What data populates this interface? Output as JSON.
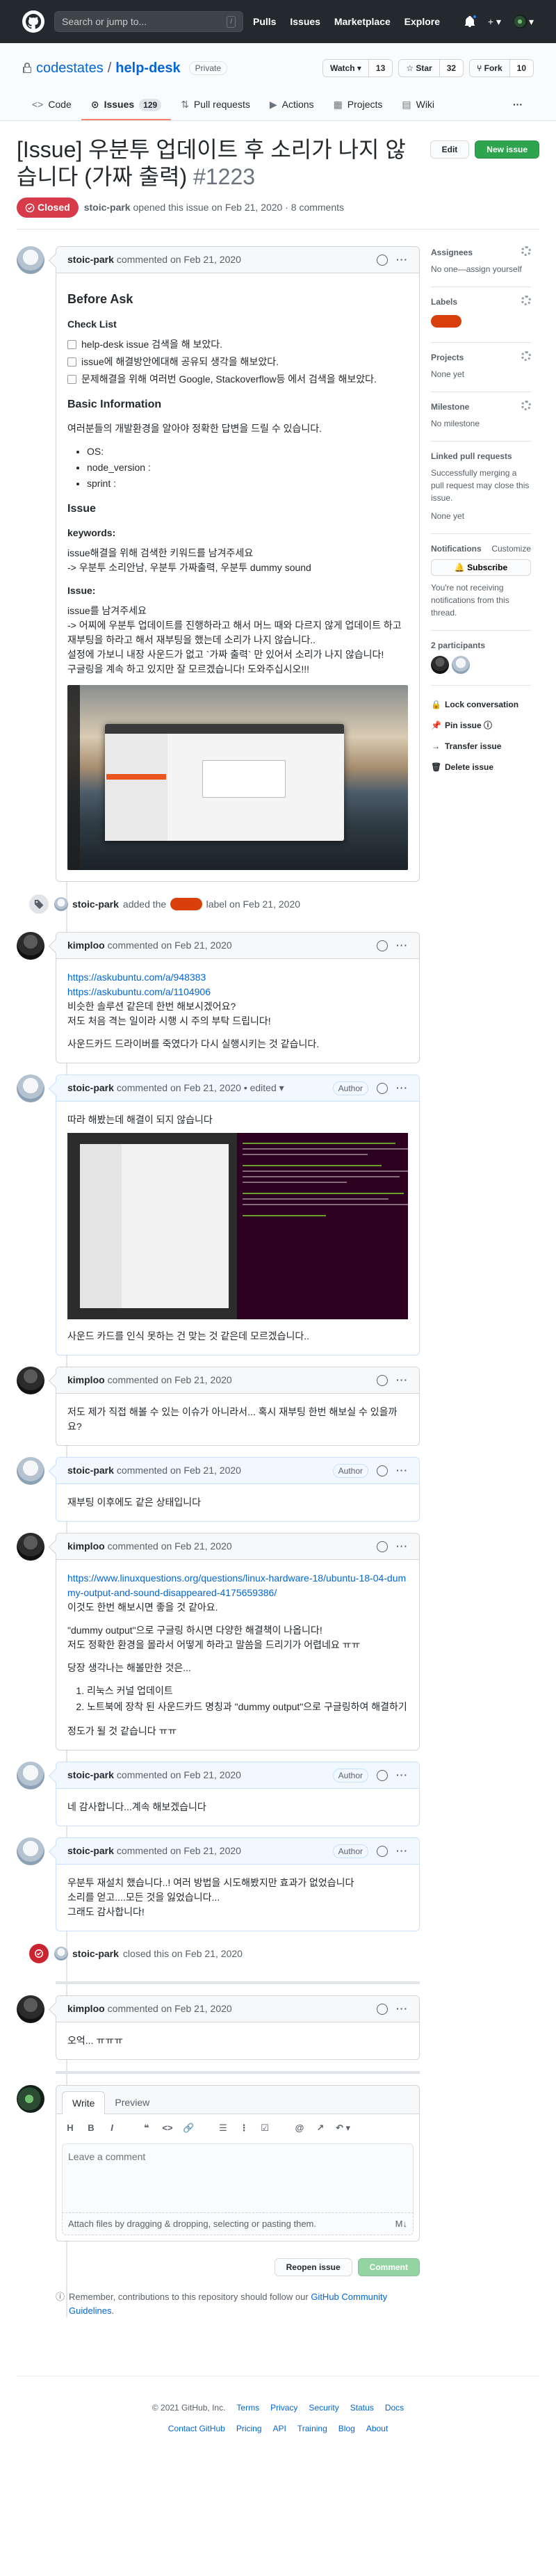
{
  "header": {
    "search_placeholder": "Search or jump to...",
    "search_key": "/",
    "nav": [
      "Pulls",
      "Issues",
      "Marketplace",
      "Explore"
    ],
    "plus_label": "+ ▾",
    "profile_label": "▾"
  },
  "repo": {
    "owner": "codestates",
    "separator": "/",
    "name": "help-desk",
    "visibility": "Private",
    "watch_label": "Watch ▾",
    "watch_count": "13",
    "star_label": "☆ Star",
    "star_count": "32",
    "fork_label": "Fork",
    "fork_count": "10",
    "tabs": [
      {
        "label": "Code",
        "icon": "<>"
      },
      {
        "label": "Issues",
        "icon": "⊙",
        "count": "129"
      },
      {
        "label": "Pull requests",
        "icon": "⇅"
      },
      {
        "label": "Actions",
        "icon": "▶"
      },
      {
        "label": "Projects",
        "icon": "▦"
      },
      {
        "label": "Wiki",
        "icon": "▤"
      }
    ],
    "more_label": "···"
  },
  "issue": {
    "title": "[Issue] 우분투 업데이트 후 소리가 나지 않습니다 (가짜 출력)",
    "number": "#1223",
    "edit_label": "Edit",
    "new_issue_label": "New issue",
    "state": "Closed",
    "author": "stoic-park",
    "opened_text": "opened this issue on Feb 21, 2020 · 8 comments"
  },
  "comments": [
    {
      "author": "stoic-park",
      "date": "commented on Feb 21, 2020",
      "badge": "",
      "body": {
        "h_before": "Before Ask",
        "h_checklist": "Check List",
        "checks": [
          "help-desk issue 검색을 해 보았다.",
          "issue에 해결방안에대해 공유되 생각을 해보았다.",
          "문제해결을 위해 여러번 Google, Stackoverflow등 에서 검색을 해보았다."
        ],
        "h_basic": "Basic Information",
        "basic_desc": "여러분들의 개발환경을 알아야 정확한 답변을 드릴 수 있습니다.",
        "env": [
          "OS:",
          "node_version :",
          "sprint :"
        ],
        "h_issue": "Issue",
        "h_keywords": "keywords:",
        "kw_line1": "issue해결을 위해 검색한 키워드를 남겨주세요",
        "kw_line2": "-> 우분투 소리안남, 우분투 가짜출력, 우분투 dummy sound",
        "h_issue2": "Issue:",
        "issue_line1": "issue를 남겨주세요",
        "issue_line2": "-> 어찌에 우분투 업데이트를 진행하라고 해서 머느 때와 다르지 않게 업데이트 하고 재부팅을 하라고 해서 재부팅을 했는데 소리가 나지 않습니다..",
        "issue_line3": "설정에 가보니 내장 사운드가 없고 `가짜 출력` 만 있어서 소리가 나지 않습니다!",
        "issue_line4": "구글링을 계속 하고 있지만 잘 모르겠습니다! 도와주십시오!!!"
      }
    },
    {
      "author": "kimploo",
      "date": "commented on Feb 21, 2020",
      "badge": "",
      "lines": [
        "https://askubuntu.com/a/948383",
        "https://askubuntu.com/a/1104906",
        "비슷한 솔루션 같은데 한번 해보시겠어요?",
        "저도 처음 격는 일이라 시행 시 주의 부탁 드립니다!",
        "사운드카드 드라이버를 죽였다가 다시 실행시키는 것 같습니다."
      ]
    },
    {
      "author": "stoic-park",
      "date": "commented on Feb 21, 2020 • edited ▾",
      "badge": "Author",
      "line1": "따라 해봤는데 해결이 되지 않습니다",
      "line2": "사운드 카드를 인식 못하는 건 맞는 것 같은데 모르겠습니다.."
    },
    {
      "author": "kimploo",
      "date": "commented on Feb 21, 2020",
      "text": "저도 제가 직접 해볼 수 있는 이슈가 아니라서... 혹시 재부팅 한번 해보실 수 있을까요?"
    },
    {
      "author": "stoic-park",
      "date": "commented on Feb 21, 2020",
      "badge": "Author",
      "text": "재부팅 이후에도 같은 상태입니다"
    },
    {
      "author": "kimploo",
      "date": "commented on Feb 21, 2020",
      "link": "https://www.linuxquestions.org/questions/linux-hardware-18/ubuntu-18-04-dummy-output-and-sound-disappeared-4175659386/",
      "line1": "이것도 한번 해보시면 좋을 것 같아요.",
      "line2": "\"dummy output\"으로 구글링 하시면 다양한 해결책이 나옵니다!",
      "line3": "저도 정확한 환경을 몰라서 어떻게 하라고 말씀을 드리기가 어렵네요 ㅠㅠ",
      "line4": "당장 생각나는 해볼만한 것은...",
      "items": [
        "리눅스 커널 업데이트",
        "노트북에 장착 된 사운드카드 명칭과 \"dummy output\"으로 구글링하여 해결하기"
      ],
      "line5": "정도가 될 것 같습니다 ㅠㅠ"
    },
    {
      "author": "stoic-park",
      "date": "commented on Feb 21, 2020",
      "badge": "Author",
      "text": "네 감사합니다...계속 해보겠습니다"
    },
    {
      "author": "stoic-park",
      "date": "commented on Feb 21, 2020",
      "badge": "Author",
      "line1": "우분투 재설치 했습니다..! 여러 방법을 시도해봤지만 효과가 없었습니다",
      "line2": "소리를 얻고....모든 것을 잃었습니다...",
      "line3": "그래도 감사합니다!"
    },
    {
      "author": "kimploo",
      "date": "commented on Feb 21, 2020",
      "text": "오억... ㅠㅠㅠ"
    }
  ],
  "events": {
    "labeled": {
      "author": "stoic-park",
      "pre": "added the",
      "post": "label on Feb 21, 2020"
    },
    "closed": {
      "author": "stoic-park",
      "text": "closed this on Feb 21, 2020"
    }
  },
  "form": {
    "tab_write": "Write",
    "tab_preview": "Preview",
    "toolbar": [
      "H",
      "B",
      "I",
      "❝",
      "<>",
      "🔗",
      "☰",
      "⋮",
      "☑",
      "@",
      "↗",
      "↶ ▾"
    ],
    "placeholder": "Leave a comment",
    "attach_text": "Attach files by dragging & dropping, selecting or pasting them.",
    "md_icon": "M↓",
    "reopen_label": "Reopen issue",
    "comment_label": "Comment",
    "remember_pre": "Remember, contributions to this repository should follow our",
    "remember_link": "GitHub Community Guidelines",
    "remember_post": "."
  },
  "sidebar": {
    "assignees_title": "Assignees",
    "assignees_value": "No one—assign yourself",
    "labels_title": "Labels",
    "projects_title": "Projects",
    "projects_value": "None yet",
    "milestone_title": "Milestone",
    "milestone_value": "No milestone",
    "linked_title": "Linked pull requests",
    "linked_desc": "Successfully merging a pull request may close this issue.",
    "linked_value": "None yet",
    "notif_title": "Notifications",
    "notif_customize": "Customize",
    "subscribe_label": "🔔 Subscribe",
    "notif_desc": "You're not receiving notifications from this thread.",
    "participants_title": "2 participants",
    "actions": [
      {
        "icon": "🔒",
        "label": "Lock conversation"
      },
      {
        "icon": "📌",
        "label": "Pin issue ⓘ"
      },
      {
        "icon": "→",
        "label": "Transfer issue"
      },
      {
        "icon": "🗑",
        "label": "Delete issue"
      }
    ]
  },
  "footer": {
    "copyright": "© 2021 GitHub, Inc.",
    "row1": [
      "Terms",
      "Privacy",
      "Security",
      "Status",
      "Docs"
    ],
    "row2": [
      "Contact GitHub",
      "Pricing",
      "API",
      "Training",
      "Blog",
      "About"
    ]
  }
}
